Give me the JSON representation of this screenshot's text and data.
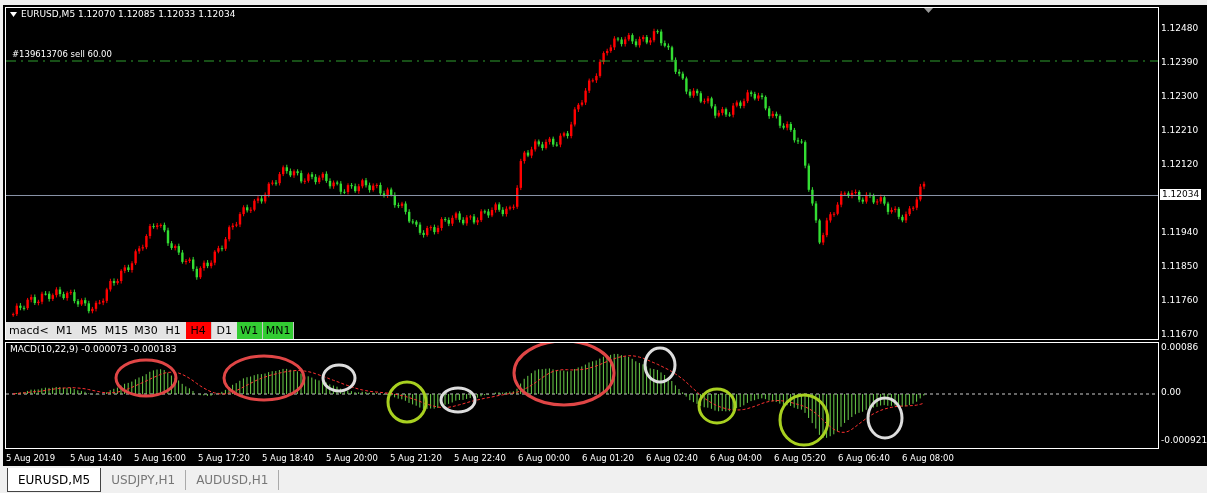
{
  "chart": {
    "title": "EURUSD,M5  1.12070 1.12085 1.12033 1.12034",
    "order": {
      "label": "#139613706 sell 60.00"
    },
    "price_axis": [
      "1.12480",
      "1.12390",
      "1.12300",
      "1.12210",
      "1.12120",
      "1.11940",
      "1.11850",
      "1.11760",
      "1.11670"
    ],
    "current_price": "1.12034"
  },
  "periods": {
    "label": "macd<",
    "items": [
      {
        "label": "M1"
      },
      {
        "label": "M5"
      },
      {
        "label": "M15"
      },
      {
        "label": "M30"
      },
      {
        "label": "H1"
      },
      {
        "label": "H4",
        "color": "#ff0000"
      },
      {
        "label": "D1"
      },
      {
        "label": "W1",
        "color": "#33cc33"
      },
      {
        "label": "MN1",
        "color": "#33cc33"
      }
    ]
  },
  "macd": {
    "title": "MACD(10,22,9) -0.000073 -0.000183",
    "axis": [
      "0.00086",
      "0.00",
      "-0.000921"
    ]
  },
  "time_axis": [
    "5 Aug 2019",
    "5 Aug 14:40",
    "5 Aug 16:00",
    "5 Aug 17:20",
    "5 Aug 18:40",
    "5 Aug 20:00",
    "5 Aug 21:20",
    "5 Aug 22:40",
    "6 Aug 00:00",
    "6 Aug 01:20",
    "6 Aug 02:40",
    "6 Aug 04:00",
    "6 Aug 05:20",
    "6 Aug 06:40",
    "6 Aug 08:00"
  ],
  "tabs": [
    {
      "label": "EURUSD,M5",
      "selected": true
    },
    {
      "label": "USDJPY,H1",
      "selected": false
    },
    {
      "label": "AUDUSD,H1",
      "selected": false
    }
  ]
}
